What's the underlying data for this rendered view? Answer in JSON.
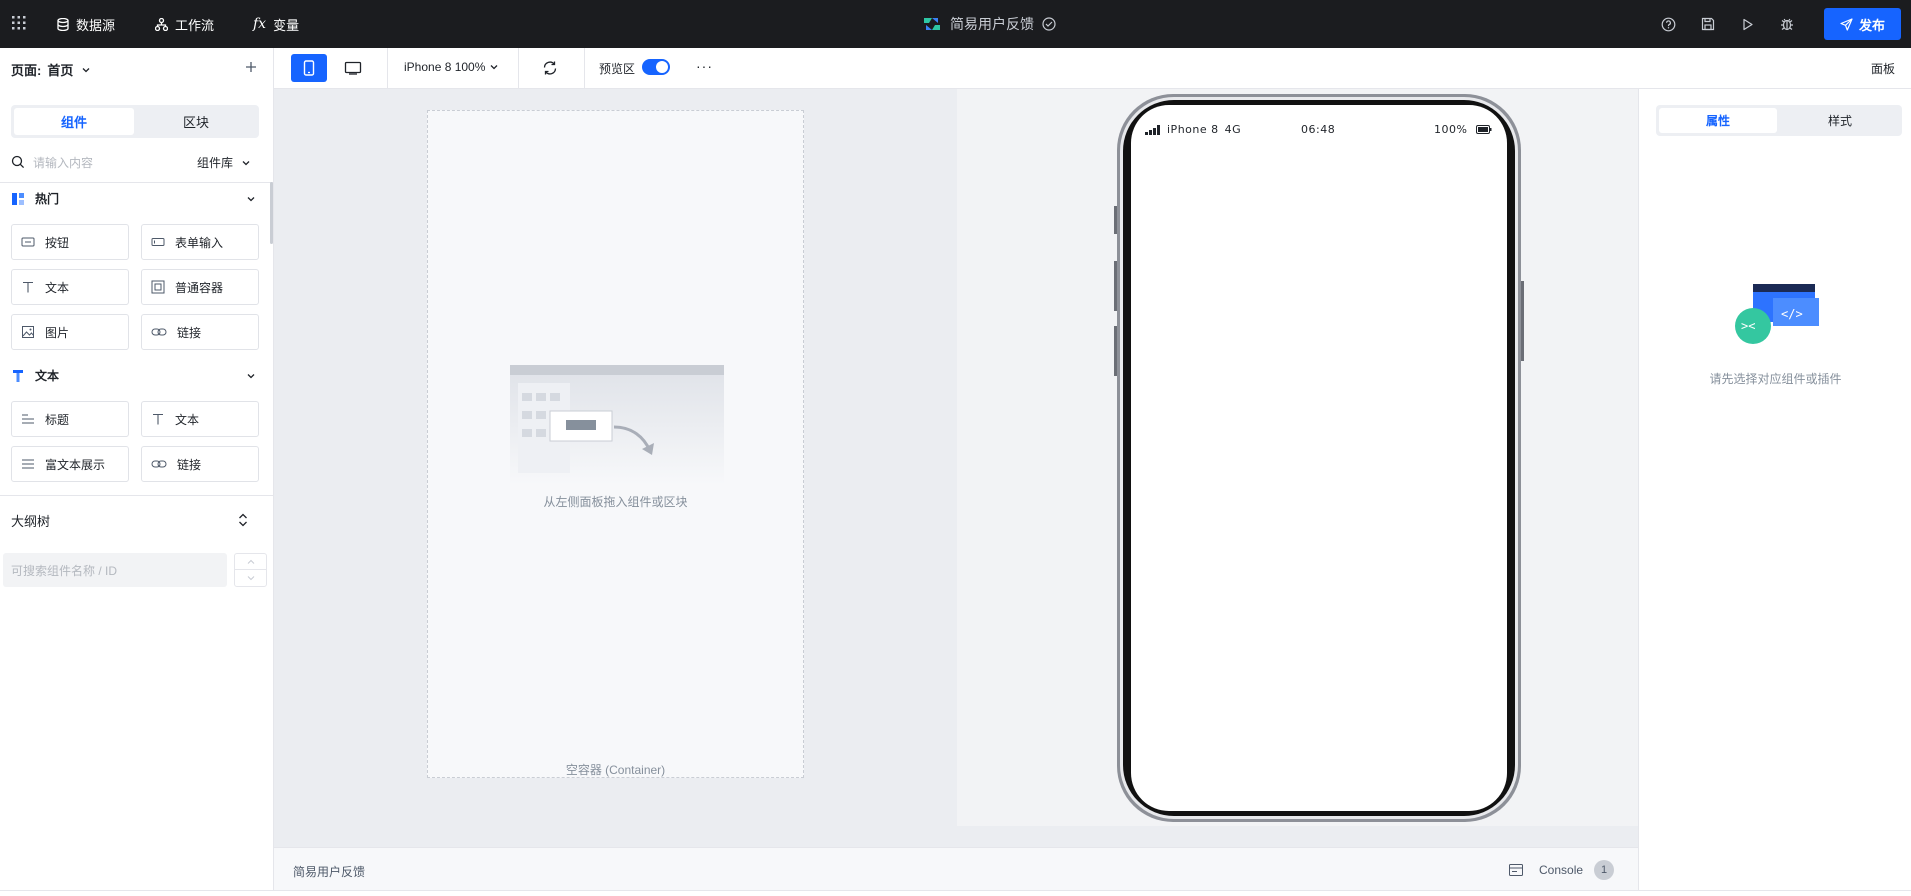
{
  "header": {
    "nav": [
      {
        "label": "数据源",
        "icon": "database-icon"
      },
      {
        "label": "工作流",
        "icon": "workflow-icon"
      },
      {
        "label": "变量",
        "icon": "function-icon"
      }
    ],
    "app_title": "简易用户反馈",
    "actions": [
      "help-icon",
      "save-icon",
      "run-icon",
      "debug-icon"
    ],
    "publish_label": "发布",
    "accent_color": "#1664ff"
  },
  "left_panel": {
    "page_label": "页面:",
    "page_name": "首页",
    "tabs": [
      {
        "label": "组件",
        "active": true
      },
      {
        "label": "区块",
        "active": false
      }
    ],
    "search_placeholder": "请输入内容",
    "library_label": "组件库",
    "categories": [
      {
        "name": "热门",
        "items": [
          {
            "label": "按钮",
            "icon": "button-icon"
          },
          {
            "label": "表单输入",
            "icon": "input-icon"
          },
          {
            "label": "文本",
            "icon": "text-icon"
          },
          {
            "label": "普通容器",
            "icon": "container-icon"
          },
          {
            "label": "图片",
            "icon": "image-icon"
          },
          {
            "label": "链接",
            "icon": "link-icon"
          }
        ]
      },
      {
        "name": "文本",
        "items": [
          {
            "label": "标题",
            "icon": "heading-icon"
          },
          {
            "label": "文本",
            "icon": "text-icon"
          },
          {
            "label": "富文本展示",
            "icon": "rich-text-icon"
          },
          {
            "label": "链接",
            "icon": "link-icon"
          }
        ]
      }
    ],
    "outline_title": "大纲树",
    "outline_search_placeholder": "可搜索组件名称 / ID"
  },
  "toolbar": {
    "device_label": "iPhone 8 100%",
    "preview_label": "预览区",
    "preview_enabled": true,
    "more_label": "···",
    "panel_label": "面板"
  },
  "canvas": {
    "drop_hint": "从左侧面板拖入组件或区块",
    "container_caption": "空容器 (Container)"
  },
  "phone": {
    "carrier": "iPhone 8",
    "network": "4G",
    "time": "06:48",
    "battery": "100%"
  },
  "right_panel": {
    "tabs": [
      {
        "label": "属性",
        "active": true
      },
      {
        "label": "样式",
        "active": false
      }
    ],
    "empty_hint": "请先选择对应组件或插件"
  },
  "footer": {
    "title": "简易用户反馈",
    "console_label": "Console",
    "console_count": "1"
  }
}
